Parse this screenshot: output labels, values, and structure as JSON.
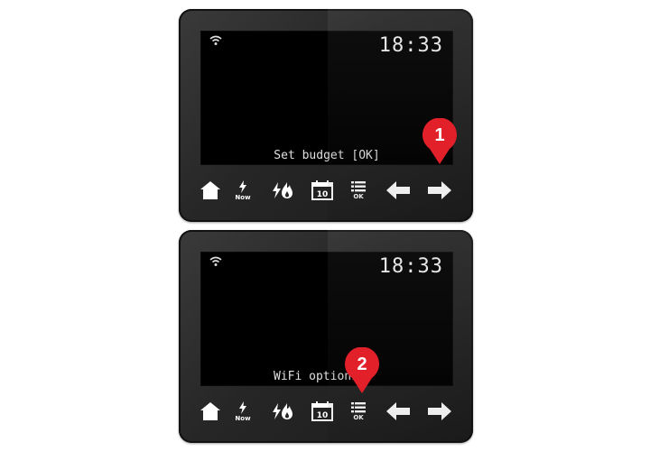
{
  "devices": [
    {
      "clock": "18:33",
      "message": "Set budget [OK]",
      "buttons": {
        "now_label": "Now",
        "calendar_day": "10",
        "ok_label": "OK"
      }
    },
    {
      "clock": "18:33",
      "message": "WiFi options",
      "buttons": {
        "now_label": "Now",
        "calendar_day": "10",
        "ok_label": "OK"
      }
    }
  ],
  "callouts": [
    {
      "number": "1",
      "color": "#e2202a"
    },
    {
      "number": "2",
      "color": "#e2202a"
    }
  ]
}
